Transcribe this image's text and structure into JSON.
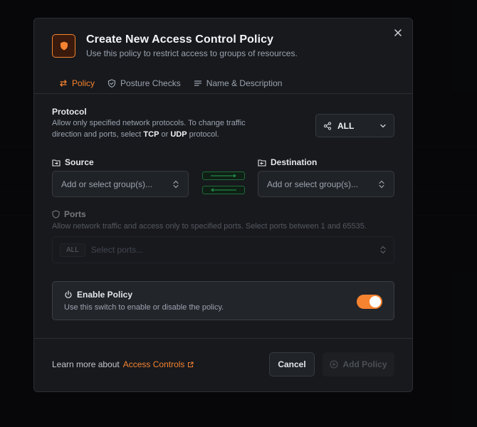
{
  "modal": {
    "title": "Create New Access Control Policy",
    "subtitle": "Use this policy to restrict access to groups of resources.",
    "icon": "shield-icon"
  },
  "tabs": [
    {
      "label": "Policy",
      "icon": "arrows-exchange-icon",
      "active": true
    },
    {
      "label": "Posture Checks",
      "icon": "shield-check-icon",
      "active": false
    },
    {
      "label": "Name & Description",
      "icon": "text-lines-icon",
      "active": false
    }
  ],
  "protocol": {
    "label": "Protocol",
    "desc_1": "Allow only specified network protocols. To change traffic direction and ports, select ",
    "tcp": "TCP",
    "or": " or ",
    "udp": "UDP",
    "desc_2": " protocol.",
    "selected": "ALL"
  },
  "source": {
    "label": "Source",
    "placeholder": "Add or select group(s)..."
  },
  "destination": {
    "label": "Destination",
    "placeholder": "Add or select group(s)..."
  },
  "ports": {
    "label": "Ports",
    "desc": "Allow network traffic and access only to specified ports. Select ports between 1 and 65535.",
    "tag": "ALL",
    "placeholder": "Select ports..."
  },
  "enable": {
    "title": "Enable Policy",
    "desc": "Use this switch to enable or disable the policy.",
    "enabled": true
  },
  "footer": {
    "learn_prefix": "Learn more about",
    "learn_link": "Access Controls",
    "cancel": "Cancel",
    "add": "Add Policy"
  },
  "colors": {
    "accent": "#f68330",
    "flow": "#1f6b3a",
    "background": "#17191d"
  }
}
